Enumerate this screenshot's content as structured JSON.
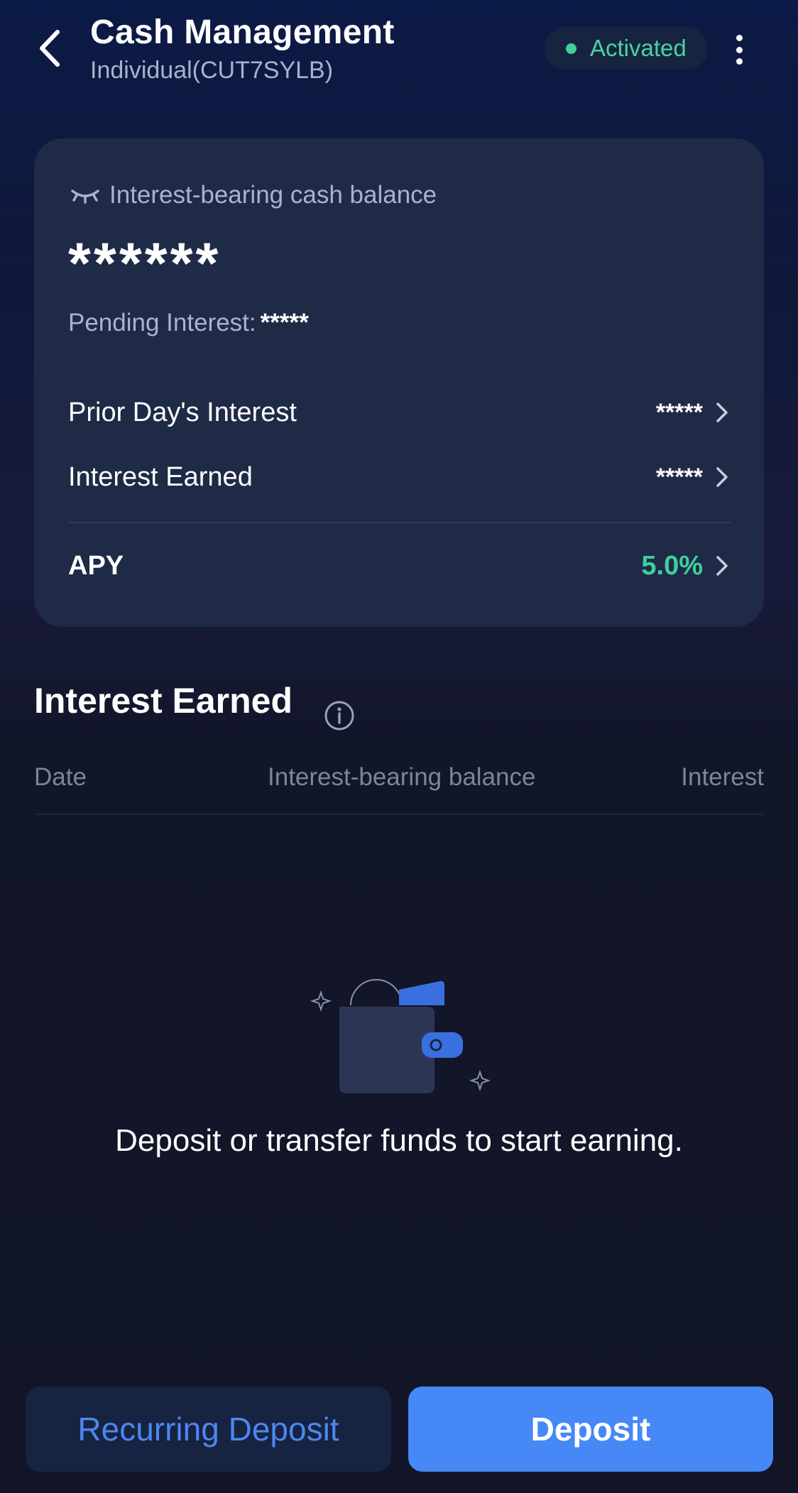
{
  "header": {
    "title": "Cash Management",
    "subtitle": "Individual(CUT7SYLB)",
    "status": "Activated",
    "back_icon": "chevron-left-icon",
    "more_icon": "more-vertical-icon",
    "status_color": "#3fcf9a"
  },
  "card": {
    "balance_label": "Interest-bearing cash balance",
    "balance_value": "******",
    "pending_label": "Pending Interest:",
    "pending_value": "*****",
    "rows": [
      {
        "label": "Prior Day's Interest",
        "value": "*****"
      },
      {
        "label": "Interest Earned",
        "value": "*****"
      }
    ],
    "apy": {
      "label": "APY",
      "value": "5.0%",
      "color": "#3fcf9a"
    }
  },
  "section": {
    "title": "Interest Earned",
    "columns": [
      "Date",
      "Interest-bearing balance",
      "Interest"
    ],
    "empty_message": "Deposit or transfer funds to start earning."
  },
  "actions": {
    "recurring_label": "Recurring Deposit",
    "deposit_label": "Deposit",
    "deposit_color": "#4688f5"
  }
}
